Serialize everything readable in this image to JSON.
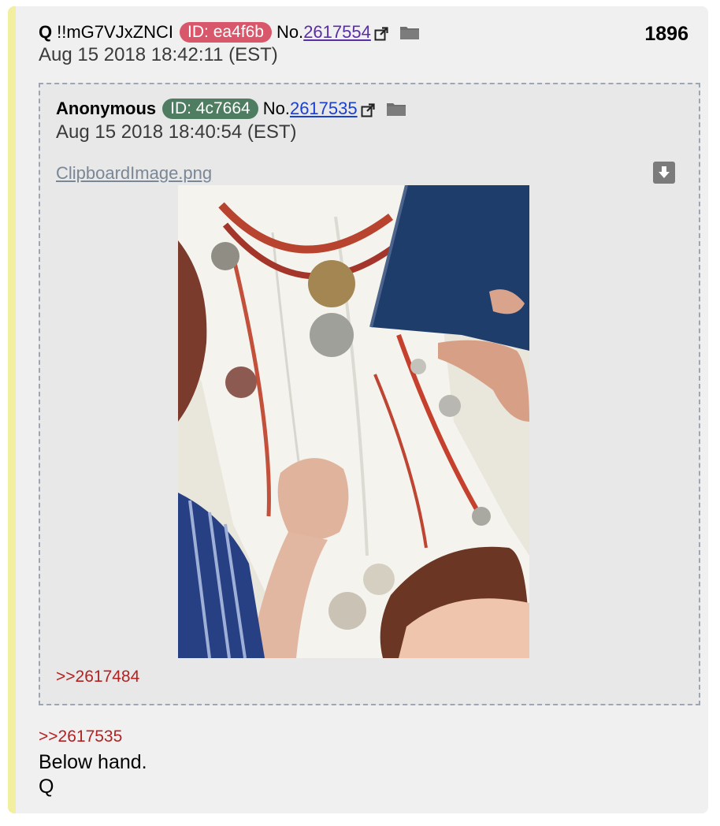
{
  "post": {
    "author": "Q",
    "tripcode": "!!mG7VJxZNCI",
    "id_badge": "ID: ea4f6b",
    "id_color": "#d9576b",
    "no_label": "No.",
    "post_no": "2617554",
    "count": "1896",
    "date": "Aug 15 2018 18:42:11 (EST)",
    "reply_link": ">>2617535",
    "body_lines": [
      "Below hand.",
      "Q"
    ]
  },
  "quoted": {
    "author": "Anonymous",
    "id_badge": "ID: 4c7664",
    "id_color": "#4f7d62",
    "no_label": "No.",
    "post_no": "2617535",
    "date": "Aug 15 2018 18:40:54 (EST)",
    "file_name": "ClipboardImage.png",
    "backlink": ">>2617484"
  },
  "icons": {
    "external_link": "external-link-icon",
    "folder": "folder-icon",
    "download": "download-icon"
  }
}
